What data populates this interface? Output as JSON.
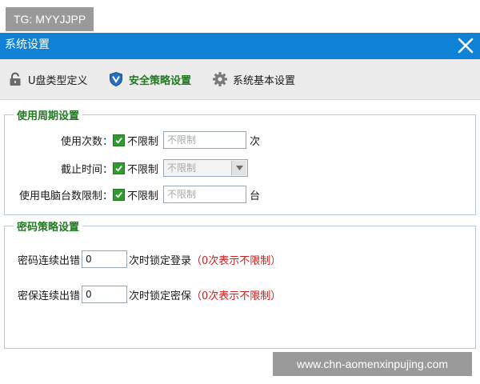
{
  "overlay": {
    "tg_text": "TG: MYYJJPP",
    "watermark": "www.chn-aomenxinpujing.com"
  },
  "window": {
    "title": "系统设置",
    "close_icon": "close-icon"
  },
  "toolbar": {
    "items": [
      {
        "label": "U盘类型定义",
        "icon": "lock-icon",
        "active": false
      },
      {
        "label": "安全策略设置",
        "icon": "shield-icon",
        "active": true
      },
      {
        "label": "系统基本设置",
        "icon": "gear-icon",
        "active": false
      }
    ]
  },
  "usage_period": {
    "legend": "使用周期设置",
    "use_count": {
      "label": "使用次数：",
      "checkbox_label": "不限制",
      "checked": true,
      "input_placeholder": "不限制",
      "unit": "次"
    },
    "deadline": {
      "label": "截止时间：",
      "checkbox_label": "不限制",
      "checked": true,
      "select_value": "不限制"
    },
    "computer_limit": {
      "label": "使用电脑台数限制：",
      "checkbox_label": "不限制",
      "checked": true,
      "input_placeholder": "不限制",
      "unit": "台"
    }
  },
  "password_policy": {
    "legend": "密码策略设置",
    "password_errors": {
      "label": "密码连续出错",
      "value": "0",
      "suffix": "次时锁定登录",
      "hint": "（0次表示不限制）"
    },
    "secret_errors": {
      "label": "密保连续出错",
      "value": "0",
      "suffix": "次时锁定密保",
      "hint": "（0次表示不限制）"
    }
  },
  "colors": {
    "titlebar": "#0d82d6",
    "accent_green": "#1f7a1f",
    "hint_red": "#cc1f1f"
  }
}
